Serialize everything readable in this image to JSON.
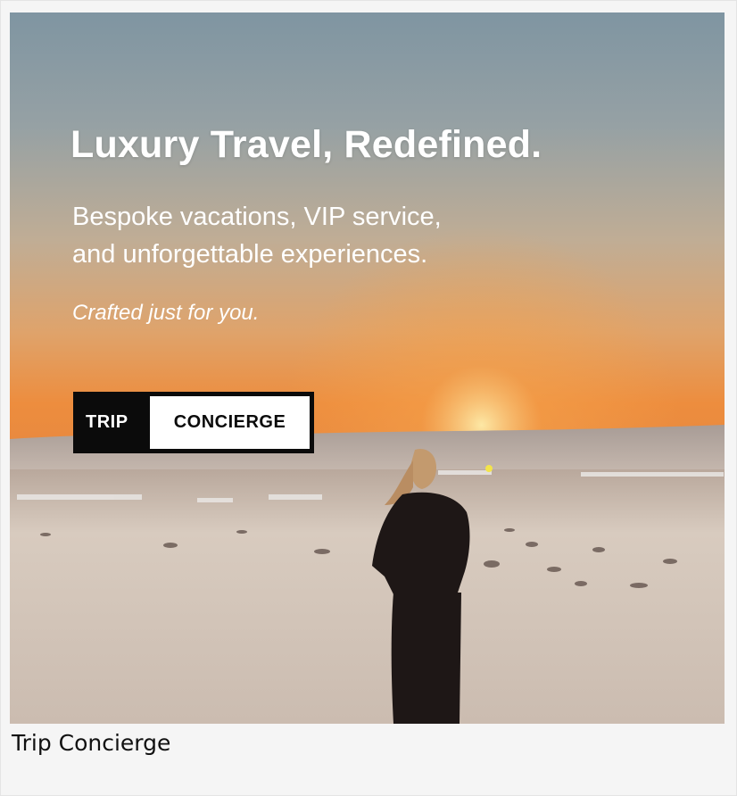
{
  "ad": {
    "headline": "Luxury Travel, Redefined.",
    "subline_1": "Bespoke vacations, VIP service,",
    "subline_2": "and unforgettable experiences.",
    "tagline": "Crafted just for you.",
    "logo": {
      "word_1": "TRIP",
      "word_2": "CONCIERGE"
    }
  },
  "caption": "Trip Concierge"
}
